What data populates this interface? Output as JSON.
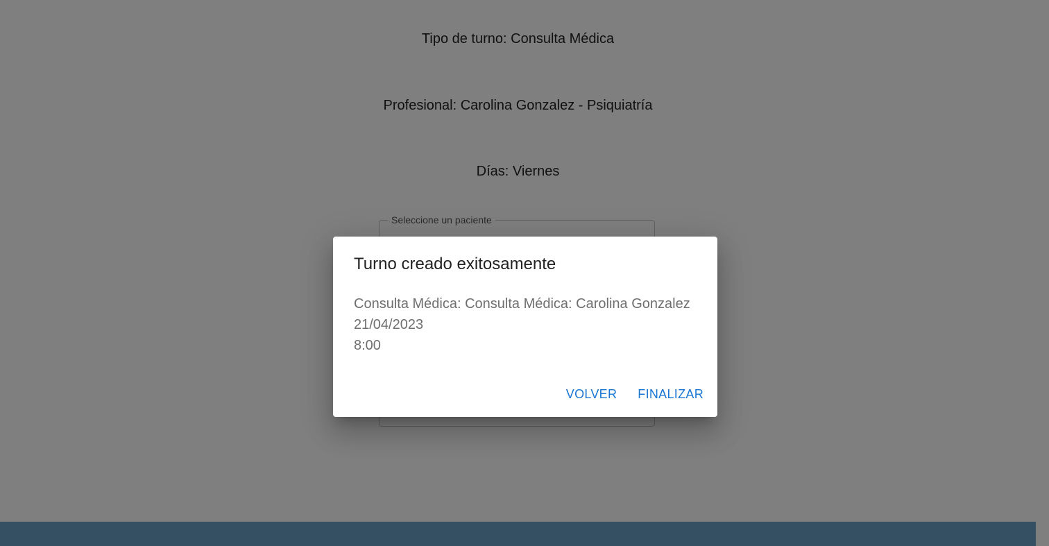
{
  "page": {
    "tipo_turno": "Tipo de turno: Consulta Médica",
    "profesional": "Profesional: Carolina Gonzalez - Psiquiatría",
    "dias": "Días: Viernes",
    "patient_select_label": "Seleccione un paciente"
  },
  "dialog": {
    "title": "Turno creado exitosamente",
    "lines": [
      "Consulta Médica: Consulta Médica: Carolina Gonzalez",
      "21/04/2023",
      "8:00"
    ],
    "actions": {
      "volver": "VOLVER",
      "finalizar": "FINALIZAR"
    }
  },
  "colors": {
    "accent": "#1976d2",
    "footer": "#6b9fc7",
    "backdrop": "rgba(0,0,0,0.5)"
  }
}
